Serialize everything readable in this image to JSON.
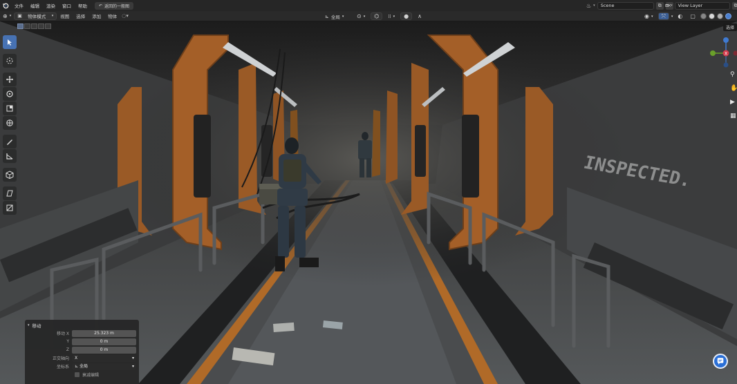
{
  "topbar": {
    "logo_icon": "blender-logo-icon",
    "menus": [
      "文件",
      "编辑",
      "渲染",
      "窗口",
      "帮助"
    ],
    "undo_chip": "返回的一般图",
    "scene_label": "Scene",
    "view_layer_label": "View Layer"
  },
  "header": {
    "editor_type_icon": "viewport-editor-icon",
    "mode_label": "物体模式",
    "menus": [
      "视图",
      "选择",
      "添加",
      "物体"
    ],
    "transform_orientation": "全局",
    "snapping_icon": "magnet-icon",
    "proportional_icon": "proportional-edit-icon"
  },
  "viewport": {
    "tooltip": "选择",
    "tools": [
      {
        "name": "select-box-icon",
        "active": true
      },
      {
        "name": "cursor-icon",
        "active": false
      },
      {
        "name": "move-icon",
        "active": false
      },
      {
        "name": "rotate-icon",
        "active": false
      },
      {
        "name": "scale-icon",
        "active": false
      },
      {
        "name": "transform-icon",
        "active": false
      },
      {
        "name": "annotate-icon",
        "active": false
      },
      {
        "name": "measure-icon",
        "active": false
      },
      {
        "name": "add-cube-icon",
        "active": false
      },
      {
        "name": "shear-icon",
        "active": false
      },
      {
        "name": "extrude-icon",
        "active": false
      }
    ],
    "wall_text": "INSPECTED."
  },
  "operator_panel": {
    "title": "移动",
    "rows": [
      {
        "label": "移动 X",
        "value": "25.323 m"
      },
      {
        "label": "Y",
        "value": "0 m"
      },
      {
        "label": "Z",
        "value": "0 m"
      }
    ],
    "orient_axis_label": "正交轴向",
    "orient_axis_value": "X",
    "orient_label": "坐标系",
    "orient_value": "全局",
    "proportional_label": "衰减编辑"
  },
  "colors": {
    "accent": "#4772b3",
    "frame_orange": "#b3662a",
    "wall_gray": "#4a4b4c"
  }
}
